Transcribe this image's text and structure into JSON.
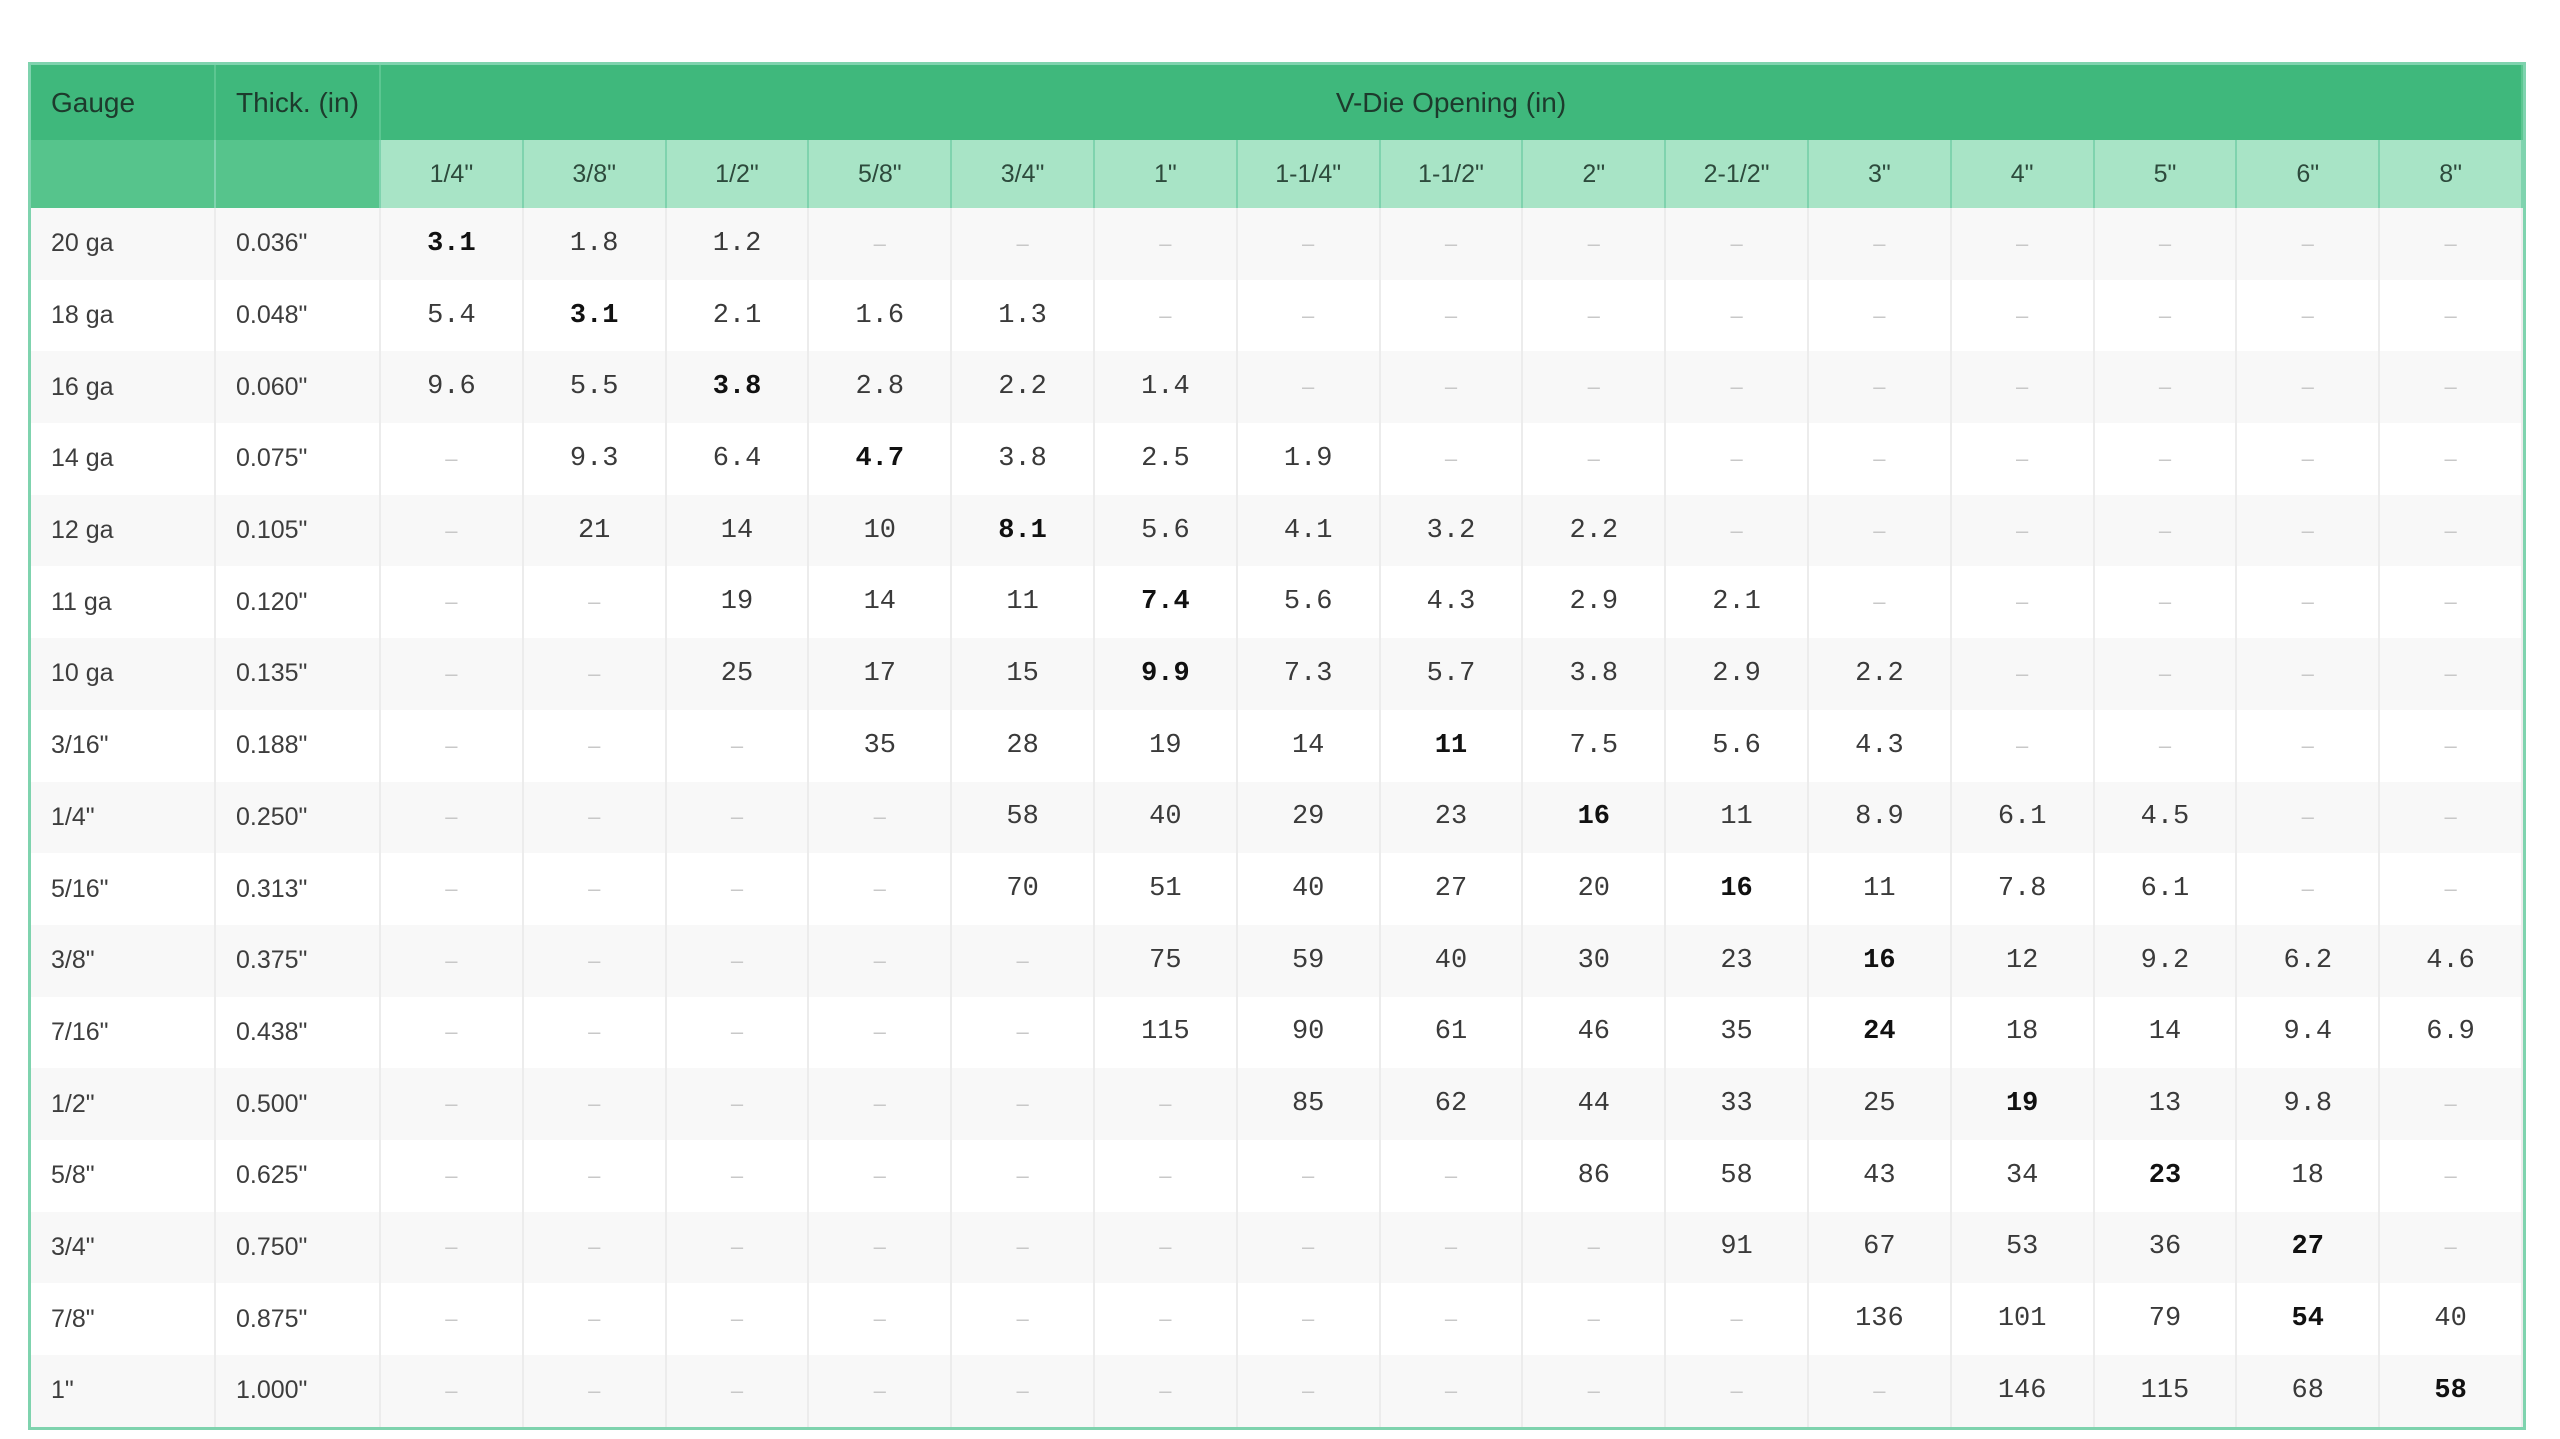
{
  "table": {
    "header": {
      "gauge": "Gauge",
      "thick": "Thick. (in)",
      "vdie": "V-Die Opening (in)"
    },
    "openings": [
      "1/4\"",
      "3/8\"",
      "1/2\"",
      "5/8\"",
      "3/4\"",
      "1\"",
      "1-1/4\"",
      "1-1/2\"",
      "2\"",
      "2-1/2\"",
      "3\"",
      "4\"",
      "5\"",
      "6\"",
      "8\""
    ],
    "rows": [
      {
        "gauge": "20 ga",
        "thick": "0.036\"",
        "bold": 0,
        "values": [
          "3.1",
          "1.8",
          "1.2",
          "–",
          "–",
          "–",
          "–",
          "–",
          "–",
          "–",
          "–",
          "–",
          "–",
          "–",
          "–"
        ]
      },
      {
        "gauge": "18 ga",
        "thick": "0.048\"",
        "bold": 1,
        "values": [
          "5.4",
          "3.1",
          "2.1",
          "1.6",
          "1.3",
          "–",
          "–",
          "–",
          "–",
          "–",
          "–",
          "–",
          "–",
          "–",
          "–"
        ]
      },
      {
        "gauge": "16 ga",
        "thick": "0.060\"",
        "bold": 2,
        "values": [
          "9.6",
          "5.5",
          "3.8",
          "2.8",
          "2.2",
          "1.4",
          "–",
          "–",
          "–",
          "–",
          "–",
          "–",
          "–",
          "–",
          "–"
        ]
      },
      {
        "gauge": "14 ga",
        "thick": "0.075\"",
        "bold": 3,
        "values": [
          "–",
          "9.3",
          "6.4",
          "4.7",
          "3.8",
          "2.5",
          "1.9",
          "–",
          "–",
          "–",
          "–",
          "–",
          "–",
          "–",
          "–"
        ]
      },
      {
        "gauge": "12 ga",
        "thick": "0.105\"",
        "bold": 4,
        "values": [
          "–",
          "21",
          "14",
          "10",
          "8.1",
          "5.6",
          "4.1",
          "3.2",
          "2.2",
          "–",
          "–",
          "–",
          "–",
          "–",
          "–"
        ]
      },
      {
        "gauge": "11 ga",
        "thick": "0.120\"",
        "bold": 5,
        "values": [
          "–",
          "–",
          "19",
          "14",
          "11",
          "7.4",
          "5.6",
          "4.3",
          "2.9",
          "2.1",
          "–",
          "–",
          "–",
          "–",
          "–"
        ]
      },
      {
        "gauge": "10 ga",
        "thick": "0.135\"",
        "bold": 5,
        "values": [
          "–",
          "–",
          "25",
          "17",
          "15",
          "9.9",
          "7.3",
          "5.7",
          "3.8",
          "2.9",
          "2.2",
          "–",
          "–",
          "–",
          "–"
        ]
      },
      {
        "gauge": "3/16\"",
        "thick": "0.188\"",
        "bold": 7,
        "values": [
          "–",
          "–",
          "–",
          "35",
          "28",
          "19",
          "14",
          "11",
          "7.5",
          "5.6",
          "4.3",
          "–",
          "–",
          "–",
          "–"
        ]
      },
      {
        "gauge": "1/4\"",
        "thick": "0.250\"",
        "bold": 8,
        "values": [
          "–",
          "–",
          "–",
          "–",
          "58",
          "40",
          "29",
          "23",
          "16",
          "11",
          "8.9",
          "6.1",
          "4.5",
          "–",
          "–"
        ]
      },
      {
        "gauge": "5/16\"",
        "thick": "0.313\"",
        "bold": 9,
        "values": [
          "–",
          "–",
          "–",
          "–",
          "70",
          "51",
          "40",
          "27",
          "20",
          "16",
          "11",
          "7.8",
          "6.1",
          "–",
          "–"
        ]
      },
      {
        "gauge": "3/8\"",
        "thick": "0.375\"",
        "bold": 10,
        "values": [
          "–",
          "–",
          "–",
          "–",
          "–",
          "75",
          "59",
          "40",
          "30",
          "23",
          "16",
          "12",
          "9.2",
          "6.2",
          "4.6"
        ]
      },
      {
        "gauge": "7/16\"",
        "thick": "0.438\"",
        "bold": 10,
        "values": [
          "–",
          "–",
          "–",
          "–",
          "–",
          "115",
          "90",
          "61",
          "46",
          "35",
          "24",
          "18",
          "14",
          "9.4",
          "6.9"
        ]
      },
      {
        "gauge": "1/2\"",
        "thick": "0.500\"",
        "bold": 11,
        "values": [
          "–",
          "–",
          "–",
          "–",
          "–",
          "–",
          "85",
          "62",
          "44",
          "33",
          "25",
          "19",
          "13",
          "9.8",
          "–"
        ]
      },
      {
        "gauge": "5/8\"",
        "thick": "0.625\"",
        "bold": 12,
        "values": [
          "–",
          "–",
          "–",
          "–",
          "–",
          "–",
          "–",
          "–",
          "86",
          "58",
          "43",
          "34",
          "23",
          "18",
          "–"
        ]
      },
      {
        "gauge": "3/4\"",
        "thick": "0.750\"",
        "bold": 13,
        "values": [
          "–",
          "–",
          "–",
          "–",
          "–",
          "–",
          "–",
          "–",
          "–",
          "91",
          "67",
          "53",
          "36",
          "27",
          "–"
        ]
      },
      {
        "gauge": "7/8\"",
        "thick": "0.875\"",
        "bold": 13,
        "values": [
          "–",
          "–",
          "–",
          "–",
          "–",
          "–",
          "–",
          "–",
          "–",
          "–",
          "136",
          "101",
          "79",
          "54",
          "40"
        ]
      },
      {
        "gauge": "1\"",
        "thick": "1.000\"",
        "bold": 14,
        "values": [
          "–",
          "–",
          "–",
          "–",
          "–",
          "–",
          "–",
          "–",
          "–",
          "–",
          "–",
          "146",
          "115",
          "68",
          "58"
        ]
      }
    ]
  }
}
